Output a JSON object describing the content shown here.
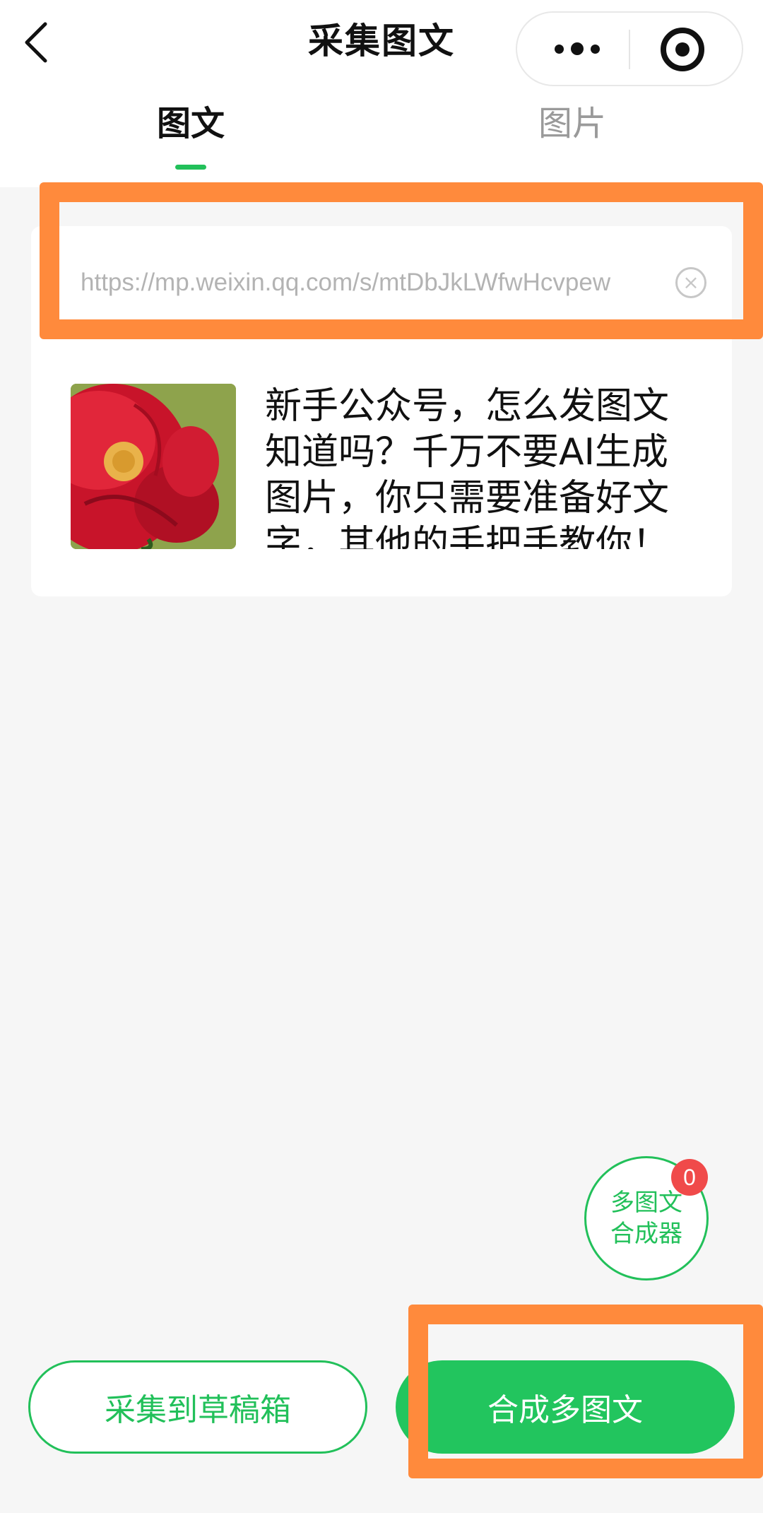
{
  "header": {
    "title": "采集图文"
  },
  "tabs": [
    {
      "label": "图文",
      "active": true
    },
    {
      "label": "图片",
      "active": false
    }
  ],
  "url_input": {
    "value": "https://mp.weixin.qq.com/s/mtDbJkLWfwHcvpew"
  },
  "article": {
    "title": "新手公众号，怎么发图文知道吗？千万不要AI生成图片，你只需要准备好文字，其他的手把手教你！",
    "thumbnail": "red-rose-image"
  },
  "merger": {
    "line1": "多图文",
    "line2": "合成器",
    "count": "0"
  },
  "buttons": {
    "draft": "采集到草稿箱",
    "merge": "合成多图文"
  },
  "colors": {
    "accent": "#22c05a",
    "highlight": "#ff8a3c",
    "badge": "#f04a4a"
  }
}
